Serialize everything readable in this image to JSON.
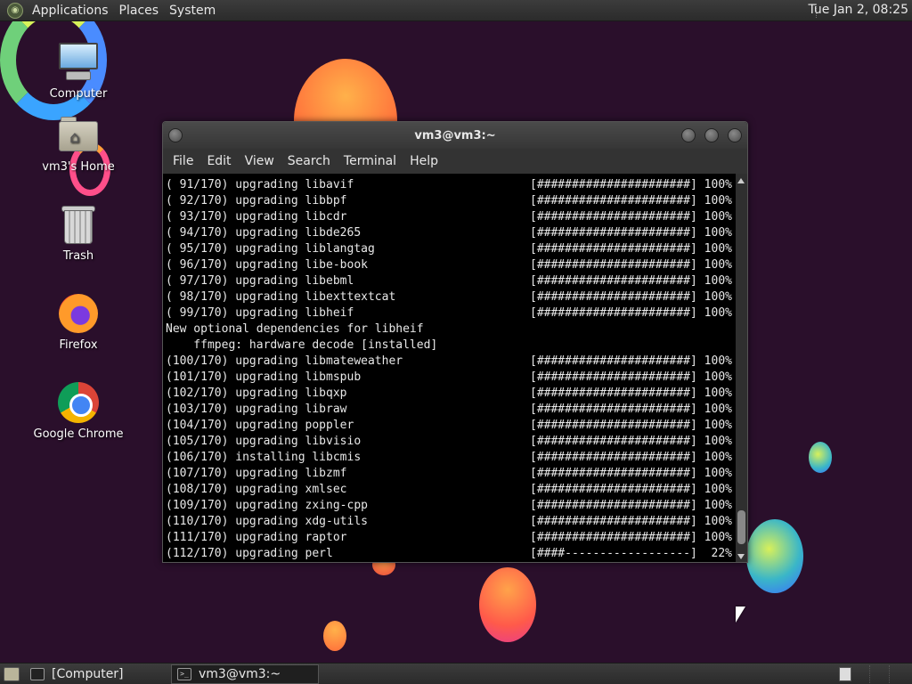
{
  "top_panel": {
    "menus": [
      "Applications",
      "Places",
      "System"
    ],
    "clock": "Tue Jan  2, 08:25"
  },
  "desktop_icons": [
    {
      "label": "Computer",
      "icon": "computer-icon"
    },
    {
      "label": "vm3's Home",
      "icon": "home-folder-icon"
    },
    {
      "label": "Trash",
      "icon": "trash-icon"
    },
    {
      "label": "Firefox",
      "icon": "firefox-icon"
    },
    {
      "label": "Google Chrome",
      "icon": "chrome-icon"
    }
  ],
  "terminal": {
    "title": "vm3@vm3:~",
    "menu": [
      "File",
      "Edit",
      "View",
      "Search",
      "Terminal",
      "Help"
    ],
    "lines": [
      {
        "text": "( 91/170) upgrading libavif",
        "bar": "[######################] 100%"
      },
      {
        "text": "( 92/170) upgrading libbpf",
        "bar": "[######################] 100%"
      },
      {
        "text": "( 93/170) upgrading libcdr",
        "bar": "[######################] 100%"
      },
      {
        "text": "( 94/170) upgrading libde265",
        "bar": "[######################] 100%"
      },
      {
        "text": "( 95/170) upgrading liblangtag",
        "bar": "[######################] 100%"
      },
      {
        "text": "( 96/170) upgrading libe-book",
        "bar": "[######################] 100%"
      },
      {
        "text": "( 97/170) upgrading libebml",
        "bar": "[######################] 100%"
      },
      {
        "text": "( 98/170) upgrading libexttextcat",
        "bar": "[######################] 100%"
      },
      {
        "text": "( 99/170) upgrading libheif",
        "bar": "[######################] 100%"
      },
      {
        "text": "New optional dependencies for libheif",
        "bar": ""
      },
      {
        "text": "    ffmpeg: hardware decode [installed]",
        "bar": ""
      },
      {
        "text": "(100/170) upgrading libmateweather",
        "bar": "[######################] 100%"
      },
      {
        "text": "(101/170) upgrading libmspub",
        "bar": "[######################] 100%"
      },
      {
        "text": "(102/170) upgrading libqxp",
        "bar": "[######################] 100%"
      },
      {
        "text": "(103/170) upgrading libraw",
        "bar": "[######################] 100%"
      },
      {
        "text": "(104/170) upgrading poppler",
        "bar": "[######################] 100%"
      },
      {
        "text": "(105/170) upgrading libvisio",
        "bar": "[######################] 100%"
      },
      {
        "text": "(106/170) installing libcmis",
        "bar": "[######################] 100%"
      },
      {
        "text": "(107/170) upgrading libzmf",
        "bar": "[######################] 100%"
      },
      {
        "text": "(108/170) upgrading xmlsec",
        "bar": "[######################] 100%"
      },
      {
        "text": "(109/170) upgrading zxing-cpp",
        "bar": "[######################] 100%"
      },
      {
        "text": "(110/170) upgrading xdg-utils",
        "bar": "[######################] 100%"
      },
      {
        "text": "(111/170) upgrading raptor",
        "bar": "[######################] 100%"
      },
      {
        "text": "(112/170) upgrading perl",
        "bar": "[####------------------]  22%"
      }
    ]
  },
  "bottom_panel": {
    "tasks": [
      {
        "label": "[Computer]",
        "active": false
      },
      {
        "label": "vm3@vm3:~",
        "active": true
      }
    ]
  }
}
